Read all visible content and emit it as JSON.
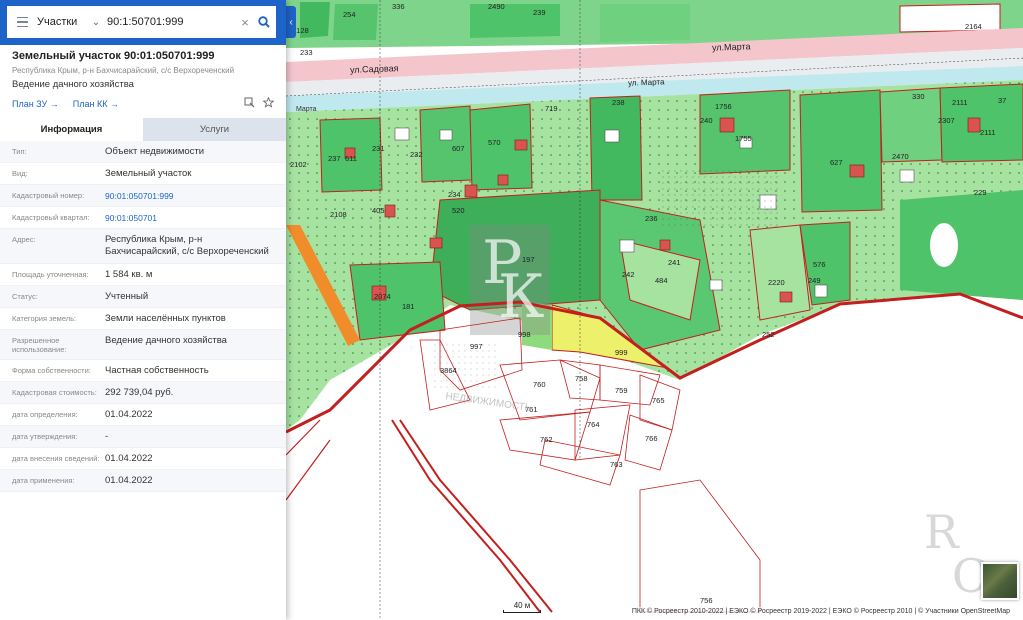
{
  "search": {
    "type": "Участки",
    "query": "90:1:50701:999"
  },
  "object": {
    "title": "Земельный участок 90:01:050701:999",
    "address": "Республика Крым, р-н Бахчисарайский, с/с Верхореченский",
    "use": "Ведение дачного хозяйства",
    "link_plan_zu": "План ЗУ →",
    "link_plan_kk": "План КК →"
  },
  "tabs": {
    "info": "Информация",
    "services": "Услуги"
  },
  "props": [
    {
      "label": "Тип:",
      "value": "Объект недвижимости"
    },
    {
      "label": "Вид:",
      "value": "Земельный участок"
    },
    {
      "label": "Кадастровый номер:",
      "value": "90:01:050701:999"
    },
    {
      "label": "Кадастровый квартал:",
      "value": "90:01:050701"
    },
    {
      "label": "Адрес:",
      "value": "Республика Крым, р-н Бахчисарайский, с/с Верхореченский"
    },
    {
      "label": "Площадь уточненная:",
      "value": "1 584 кв. м"
    },
    {
      "label": "Статус:",
      "value": "Учтенный"
    },
    {
      "label": "Категория земель:",
      "value": "Земли населённых пунктов"
    },
    {
      "label": "Разрешенное использование:",
      "value": "Ведение дачного хозяйства"
    },
    {
      "label": "Форма собственности:",
      "value": "Частная собственность"
    },
    {
      "label": "Кадастровая стоимость:",
      "value": "292 739,04 руб."
    },
    {
      "label": "дата определения:",
      "value": "01.04.2022"
    },
    {
      "label": "дата утверждения:",
      "value": "-"
    },
    {
      "label": "дата внесения сведений:",
      "value": "01.04.2022"
    },
    {
      "label": "дата применения:",
      "value": "01.04.2022"
    }
  ],
  "map": {
    "streets": [
      "ул.Садовая",
      "ул.Марта",
      "Марта",
      "ул. Марта"
    ],
    "parcel_labels": [
      "254",
      "2128",
      "336",
      "2490",
      "2164",
      "233",
      "239",
      "999",
      "997",
      "998",
      "3864",
      "760",
      "758",
      "759",
      "765",
      "761",
      "764",
      "766",
      "762",
      "763",
      "756",
      "242",
      "484",
      "2220",
      "576",
      "249",
      "520",
      "405",
      "2108",
      "181",
      "2074",
      "611",
      "231",
      "237",
      "607",
      "570",
      "719",
      "238",
      "1756",
      "1755",
      "627",
      "2470",
      "330",
      "2111",
      "2102",
      "232",
      "234",
      "236",
      "241",
      "240",
      "252",
      "197",
      "2111",
      "37",
      "229",
      "2307"
    ],
    "scale_label": "40 м",
    "attribution": "ПКК © Росреестр 2010-2022 | ЕЭКО © Росреестр 2019-2022 | ЕЭКО © Росреестр 2010 | © Участники OpenStreetMap",
    "watermark_text": "НЕДВИЖИМОСТЬ",
    "colors": {
      "green": "#4fc36a",
      "light_green": "#a6e3a1",
      "boundary_red": "#c41e1e",
      "selected_yellow": "#ecf06a",
      "road_pink": "#f4c6cc",
      "river": "#bfe9ef"
    }
  },
  "icons": {
    "menu": "hamburger-icon",
    "search": "search-icon",
    "clear": "close-icon",
    "zoom_to": "zoom-to-icon",
    "favorite": "star-icon",
    "collapse": "chevron-left-icon"
  }
}
